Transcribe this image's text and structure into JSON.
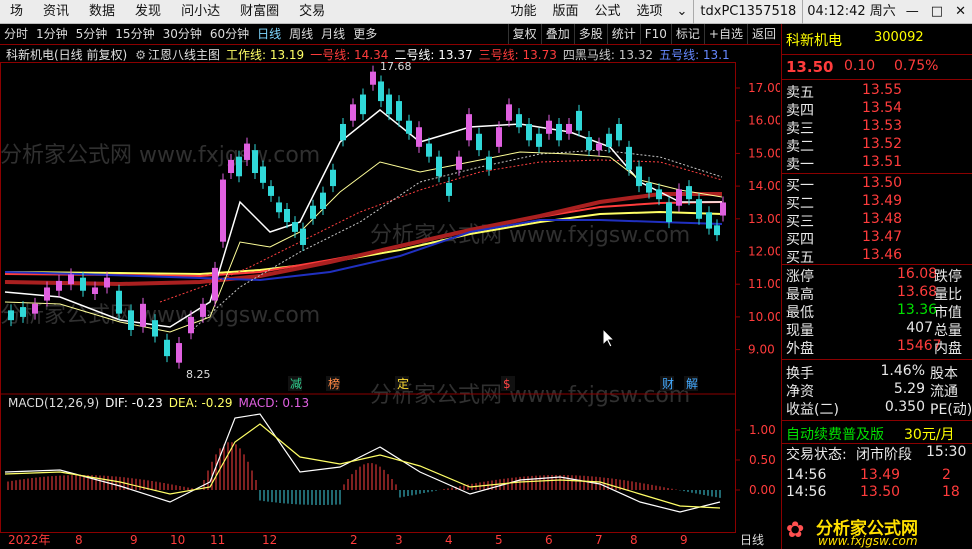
{
  "menu": {
    "items": [
      "场",
      "资讯",
      "数据",
      "发现",
      "问小达",
      "财富圈",
      "交易"
    ],
    "right_items": [
      "功能",
      "版面",
      "公式",
      "选项"
    ],
    "account": "tdxPC1357518",
    "time": "04:12:42 周六"
  },
  "periods": [
    "分时",
    "1分钟",
    "5分钟",
    "15分钟",
    "30分钟",
    "60分钟",
    "日线",
    "周线",
    "月线",
    "更多"
  ],
  "toolbar_right": [
    "复权",
    "叠加",
    "多股",
    "统计",
    "F10",
    "标记",
    "+自选",
    "返回"
  ],
  "title_line": {
    "stock": "科新机电(日线 前复权)",
    "indicator": "江恩八线主图",
    "lines": [
      {
        "label": "工作线: 13.19",
        "color": "#ffff66"
      },
      {
        "label": "一号线: 14.34",
        "color": "#ff3c3c"
      },
      {
        "label": "二号线: 13.37",
        "color": "#ffffff"
      },
      {
        "label": "三号线: 13.73",
        "color": "#ff3c3c"
      },
      {
        "label": "四黑马线: 13.32",
        "color": "#c8c8c8"
      },
      {
        "label": "五号线: 13.1",
        "color": "#6688ff"
      }
    ]
  },
  "price_axis": [
    "17.00",
    "16.00",
    "15.00",
    "14.00",
    "13.00",
    "12.00",
    "11.00",
    "10.00",
    "9.00"
  ],
  "annotations": {
    "high": "17.68",
    "low": "8.25"
  },
  "event_labels": [
    {
      "text": "减",
      "color": "#30d090"
    },
    {
      "text": "榜",
      "color": "#ff8844"
    },
    {
      "text": "定",
      "color": "#ffdd33"
    },
    {
      "text": "$",
      "color": "#ff4444"
    },
    {
      "text": "财",
      "color": "#44aaff"
    },
    {
      "text": "解",
      "color": "#44aaff"
    }
  ],
  "macd": {
    "label": "MACD(12,26,9)",
    "dif": "DIF: -0.23",
    "dea": "DEA: -0.29",
    "macd": "MACD: 0.13",
    "axis": [
      "1.00",
      "0.50",
      "0.00"
    ]
  },
  "time_axis": [
    "2022年",
    "8",
    "9",
    "10",
    "11",
    "12",
    "2",
    "3",
    "4",
    "5",
    "6",
    "7",
    "8",
    "9"
  ],
  "time_axis_right": "日线",
  "quote": {
    "name": "科新机电",
    "code": "300092",
    "price": "13.50",
    "change": "0.10",
    "pct": "0.75%",
    "asks": [
      {
        "label": "卖五",
        "price": "13.55"
      },
      {
        "label": "卖四",
        "price": "13.54"
      },
      {
        "label": "卖三",
        "price": "13.53"
      },
      {
        "label": "卖二",
        "price": "13.52"
      },
      {
        "label": "卖一",
        "price": "13.51"
      }
    ],
    "bids": [
      {
        "label": "买一",
        "price": "13.50"
      },
      {
        "label": "买二",
        "price": "13.49"
      },
      {
        "label": "买三",
        "price": "13.48"
      },
      {
        "label": "买四",
        "price": "13.47"
      },
      {
        "label": "买五",
        "price": "13.46"
      }
    ],
    "stats": [
      {
        "l1": "涨停",
        "v1": "16.08",
        "c1": "red",
        "l2": "跌停"
      },
      {
        "l1": "最高",
        "v1": "13.68",
        "c1": "red",
        "l2": "量比"
      },
      {
        "l1": "最低",
        "v1": "13.36",
        "c1": "grn",
        "l2": "市值"
      },
      {
        "l1": "现量",
        "v1": "407",
        "c1": "wht",
        "l2": "总量"
      },
      {
        "l1": "外盘",
        "v1": "15467",
        "c1": "red",
        "l2": "内盘"
      }
    ],
    "stats2": [
      {
        "l1": "换手",
        "v1": "1.46%",
        "l2": "股本"
      },
      {
        "l1": "净资",
        "v1": "5.29",
        "l2": "流通"
      },
      {
        "l1": "收益(二)",
        "v1": "0.350",
        "l2": "PE(动)"
      }
    ],
    "renew_text": "自动续费普及版",
    "renew_price": "30元/月",
    "trade_status_label": "交易状态:",
    "trade_status": "闭市阶段",
    "trade_time": "15:30",
    "ticks": [
      {
        "t": "14:56",
        "p": "13.49",
        "v": "2"
      },
      {
        "t": "14:56",
        "p": "13.50",
        "v": "18"
      }
    ],
    "watermark": "分析家公式网",
    "watermark_url": "www.fxjgsw.com"
  },
  "bg_watermark": "分析家公式网 www.fxjgsw.com"
}
